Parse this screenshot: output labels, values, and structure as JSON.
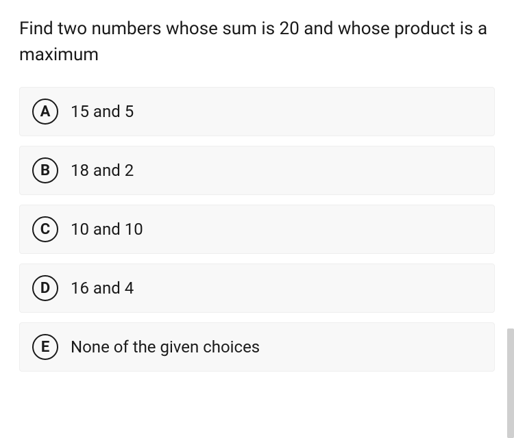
{
  "question": "Find two numbers whose sum is 20 and whose product is a maximum",
  "options": [
    {
      "letter": "A",
      "text": "15 and 5"
    },
    {
      "letter": "B",
      "text": "18 and 2"
    },
    {
      "letter": "C",
      "text": "10 and 10"
    },
    {
      "letter": "D",
      "text": "16 and 4"
    },
    {
      "letter": "E",
      "text": "None of the given choices"
    }
  ]
}
